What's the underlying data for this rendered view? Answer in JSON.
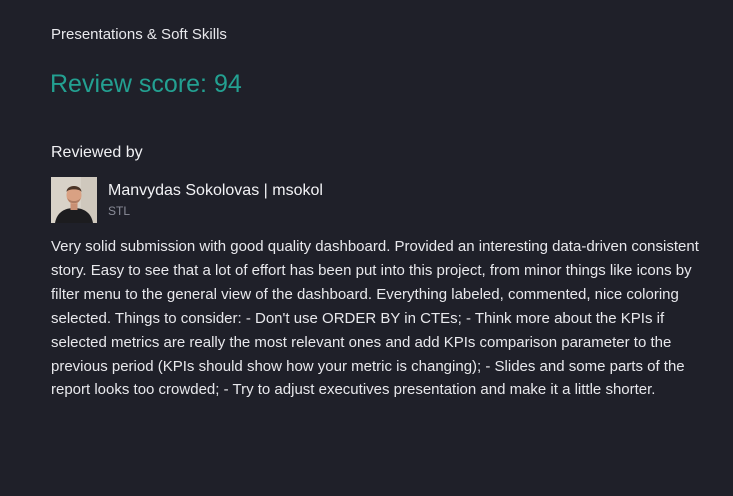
{
  "review": {
    "section_title": "Presentations & Soft Skills",
    "score_label": "Review score: 94",
    "reviewed_by_label": "Reviewed by",
    "reviewer": {
      "name": "Manvydas Sokolovas | msokol",
      "role": "STL",
      "avatar_icon": "reviewer-photo"
    },
    "comment": "Very solid submission with good quality dashboard. Provided an interesting data-driven consistent story. Easy to see that a lot of effort has been put into this project, from minor things like icons by filter menu to the general view of the dashboard. Everything labeled, commented, nice coloring selected. Things to consider: - Don't use ORDER BY in CTEs; - Think more about the KPIs if selected metrics are really the most relevant ones and add KPIs comparison parameter to the previous period (KPIs should show how your metric is changing); - Slides and some parts of the report looks too crowded; - Try to adjust executives presentation and make it a little shorter."
  },
  "colors": {
    "background": "#1f2029",
    "score_accent": "#23a091",
    "muted_text": "#8b8d99"
  }
}
